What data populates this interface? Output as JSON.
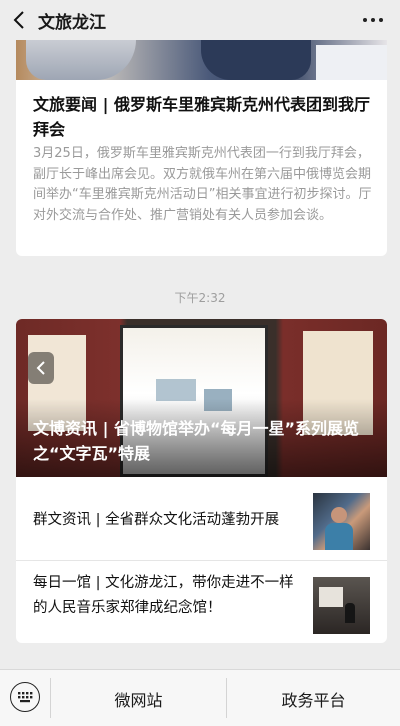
{
  "nav": {
    "title": "文旅龙江",
    "back_icon": "chevron-left-icon",
    "more_icon": "more-dots-icon"
  },
  "message1": {
    "title": "文旅要闻 | 俄罗斯车里雅宾斯克州代表团到我厅拜会",
    "description": "3月25日，俄罗斯车里雅宾斯克州代表团一行到我厅拜会，副厅长于峰出席会见。双方就俄车州在第六届中俄博览会期间举办“车里雅宾斯克州活动日”相关事宜进行初步探讨。厅对外交流与合作处、推广营销处有关人员参加会谈。"
  },
  "timestamp": "下午2:32",
  "message2": {
    "hero_title": "文博资讯 | 省博物馆举办“每月一星”系列展览之“文字瓦”特展",
    "items": [
      {
        "title": "群文资讯 | 全省群众文化活动蓬勃开展"
      },
      {
        "title": "每日一馆 | 文化游龙江，带你走进不一样的人民音乐家郑律成纪念馆！"
      }
    ]
  },
  "bottom_menu": {
    "keyboard_icon": "keyboard-icon",
    "items": [
      {
        "label": "微网站"
      },
      {
        "label": "政务平台"
      }
    ]
  },
  "colors": {
    "background": "#ededed",
    "card": "#ffffff",
    "muted_text": "#9a9a9a"
  }
}
